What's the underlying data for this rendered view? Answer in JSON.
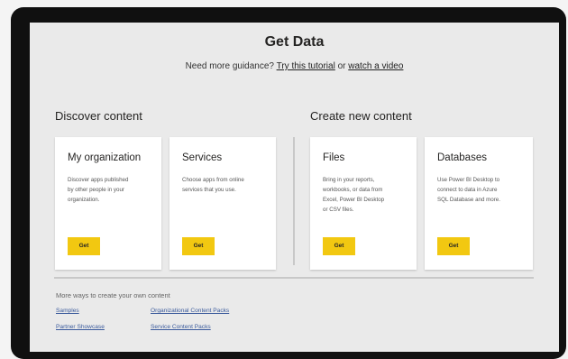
{
  "header": {
    "title": "Get Data",
    "guidance_prefix": "Need more guidance?",
    "tutorial_link": "Try this tutorial",
    "or_text": "or",
    "video_link": "watch a video"
  },
  "sections": {
    "discover": "Discover content",
    "create": "Create new content"
  },
  "cards": [
    {
      "title": "My organization",
      "desc": [
        "Discover apps published",
        "by other people in your",
        "organization."
      ],
      "button": "Get"
    },
    {
      "title": "Services",
      "desc": [
        "Choose apps from online",
        "services that you use."
      ],
      "button": "Get"
    },
    {
      "title": "Files",
      "desc": [
        "Bring in your reports,",
        "workbooks, or data from",
        "Excel, Power BI Desktop",
        "or CSV files."
      ],
      "button": "Get"
    },
    {
      "title": "Databases",
      "desc": [
        "Use Power BI Desktop to",
        "connect to data in Azure",
        "SQL Database and more."
      ],
      "button": "Get"
    }
  ],
  "more": {
    "title": "More ways to create your own content",
    "links": [
      "Samples",
      "Organizational Content Packs",
      "Partner Showcase",
      "Service Content Packs"
    ]
  },
  "colors": {
    "accent": "#f2c811",
    "background": "#eaeaea",
    "card": "#ffffff",
    "link": "#3a5a9c"
  }
}
